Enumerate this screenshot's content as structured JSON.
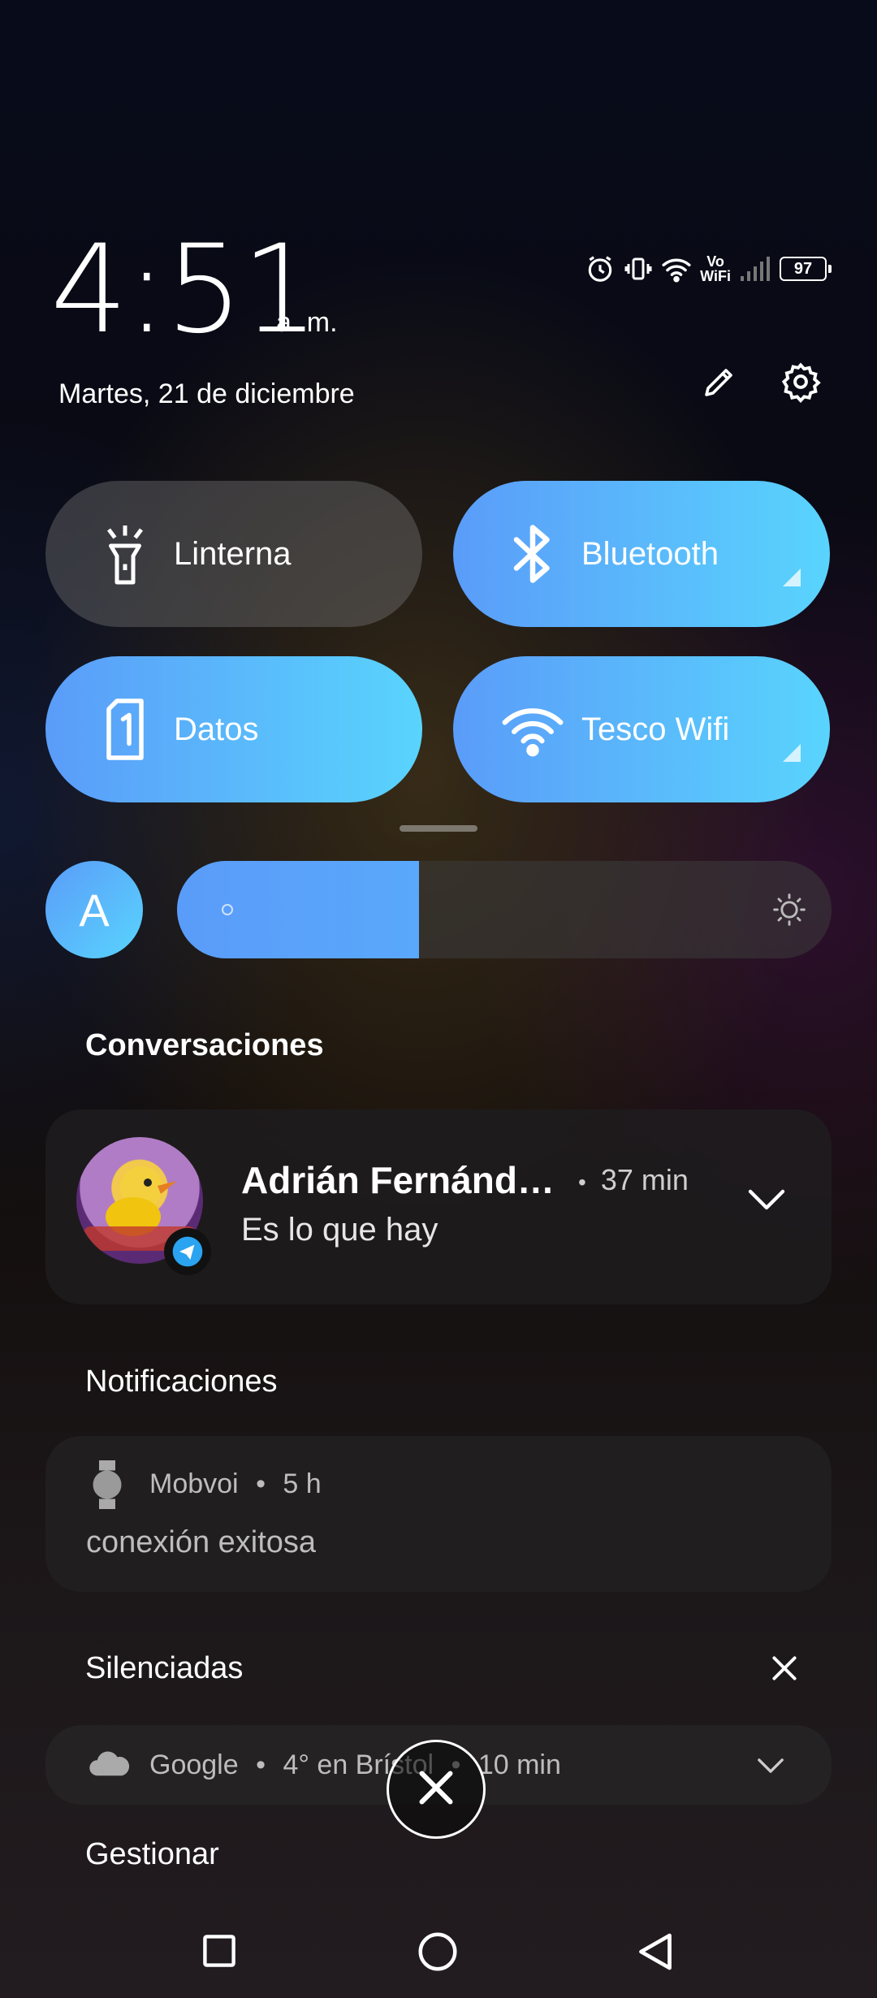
{
  "status": {
    "time": "4:51",
    "ampm": "a. m.",
    "date": "Martes, 21 de diciembre",
    "volte_top": "Vo",
    "volte_bottom": "WiFi",
    "battery": "97"
  },
  "tiles": [
    {
      "label": "Linterna",
      "icon": "flashlight-icon",
      "state": "off"
    },
    {
      "label": "Bluetooth",
      "icon": "bluetooth-icon",
      "state": "on"
    },
    {
      "label": "Datos",
      "icon": "sim-card-icon",
      "state": "on"
    },
    {
      "label": "Tesco Wifi",
      "icon": "wifi-icon",
      "state": "on"
    }
  ],
  "brightness": {
    "auto_label": "A",
    "level": 0.37
  },
  "sections": {
    "conversations": "Conversaciones",
    "notifications": "Notificaciones",
    "silenced": "Silenciadas",
    "manage": "Gestionar"
  },
  "conversation": {
    "name": "Adrián Fernánd…",
    "dot": "•",
    "time": "37 min",
    "message": "Es lo que hay"
  },
  "notification": {
    "app": "Mobvoi",
    "dot": "•",
    "time": "5 h",
    "text": "conexión exitosa"
  },
  "silenced_item": {
    "app": "Google",
    "dot": "•",
    "text": "4° en Brístol",
    "dot2": "•",
    "time": "10 min"
  },
  "colors": {
    "tile_on_start": "#5a9cf9",
    "tile_on_end": "#59d4fd"
  }
}
